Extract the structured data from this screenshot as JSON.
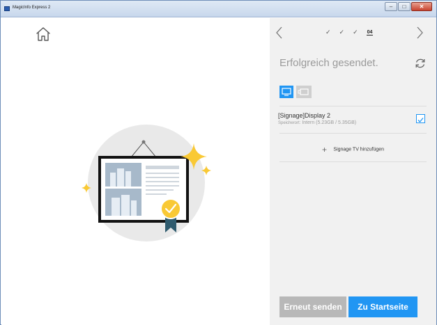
{
  "window": {
    "title": "MagicInfo Express 2",
    "controls": {
      "minimize": "–",
      "maximize": "□",
      "close": "✕"
    }
  },
  "left_pane": {
    "home_icon": "home-icon",
    "illustration": "framed-signage-with-badge-illustration"
  },
  "right_pane": {
    "stepper": {
      "completed_steps": [
        "✓",
        "✓",
        "✓"
      ],
      "current_step": "04"
    },
    "status_title": "Erfolgreich gesendet.",
    "tabs": [
      {
        "icon": "display-icon",
        "active": true
      },
      {
        "icon": "video-wall-icon",
        "active": false
      }
    ],
    "device": {
      "name": "[Signage]Display 2",
      "storage_label": "Speicherort:",
      "storage_value": "Intern (5.23GB / 5.35GB)",
      "checked": true
    },
    "add_device": {
      "icon": "+",
      "label": "Signage TV hinzufügen"
    },
    "buttons": {
      "resend": "Erneut senden",
      "home": "Zu Startseite"
    }
  },
  "colors": {
    "accent": "#2196f3",
    "panel": "#f1f1f1",
    "disabled_button": "#b8b8b8",
    "sparkle": "#f9c935",
    "badge": "#f9c935",
    "ribbon": "#2f5b6e"
  }
}
